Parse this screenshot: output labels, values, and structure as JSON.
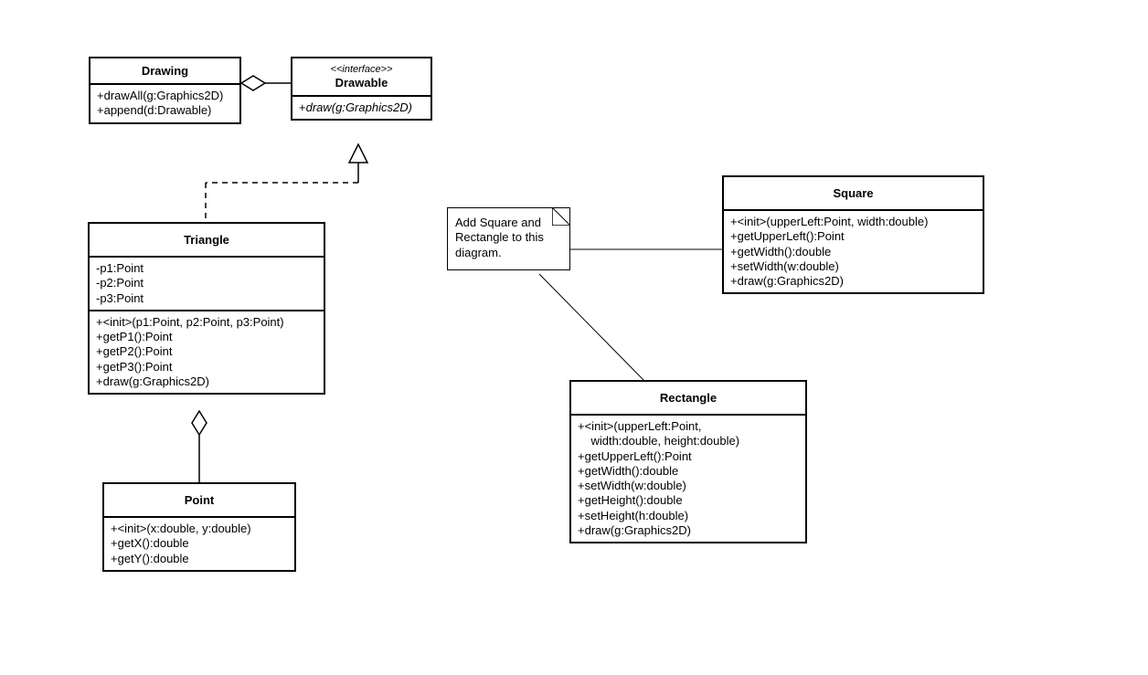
{
  "chart_data": {
    "type": "uml-class-diagram",
    "classes": [
      {
        "name": "Drawing",
        "stereotype": null,
        "attributes": [],
        "operations": [
          "+drawAll(g:Graphics2D)",
          "+append(d:Drawable)"
        ]
      },
      {
        "name": "Drawable",
        "stereotype": "<<interface>>",
        "attributes": [],
        "operations": [
          "+draw(g:Graphics2D)"
        ],
        "operationsItalic": [
          true
        ]
      },
      {
        "name": "Triangle",
        "stereotype": null,
        "attributes": [
          "-p1:Point",
          "-p2:Point",
          "-p3:Point"
        ],
        "operations": [
          "+<init>(p1:Point, p2:Point, p3:Point)",
          "+getP1():Point",
          "+getP2():Point",
          "+getP3():Point",
          "+draw(g:Graphics2D)"
        ]
      },
      {
        "name": "Point",
        "stereotype": null,
        "attributes": [],
        "operations": [
          "+<init>(x:double, y:double)",
          "+getX():double",
          "+getY():double"
        ]
      },
      {
        "name": "Square",
        "stereotype": null,
        "attributes": [],
        "operations": [
          "+<init>(upperLeft:Point, width:double)",
          "+getUpperLeft():Point",
          "+getWidth():double",
          "+setWidth(w:double)",
          "+draw(g:Graphics2D)"
        ]
      },
      {
        "name": "Rectangle",
        "stereotype": null,
        "attributes": [],
        "operations": [
          "+<init>(upperLeft:Point,\n    width:double, height:double)",
          "+getUpperLeft():Point",
          "+getWidth():double",
          "+setWidth(w:double)",
          "+getHeight():double",
          "+setHeight(h:double)",
          "+draw(g:Graphics2D)"
        ]
      }
    ],
    "note": "Add Square and\nRectangle to this\ndiagram.",
    "relationships": [
      {
        "from": "Drawing",
        "to": "Drawable",
        "type": "aggregation",
        "end": "Drawing"
      },
      {
        "from": "Triangle",
        "to": "Drawable",
        "type": "realization"
      },
      {
        "from": "Triangle",
        "to": "Point",
        "type": "aggregation",
        "end": "Triangle"
      },
      {
        "from": "note",
        "to": "Square",
        "type": "note-link"
      },
      {
        "from": "note",
        "to": "Rectangle",
        "type": "note-link"
      }
    ]
  },
  "drawing": {
    "title": "Drawing",
    "ops": [
      "+drawAll(g:Graphics2D)",
      "+append(d:Drawable)"
    ]
  },
  "drawable": {
    "stereo": "<<interface>>",
    "title": "Drawable",
    "ops": [
      "+draw(g:Graphics2D)"
    ]
  },
  "triangle": {
    "title": "Triangle",
    "attrs": [
      "-p1:Point",
      "-p2:Point",
      "-p3:Point"
    ],
    "ops": [
      "+<init>(p1:Point, p2:Point, p3:Point)",
      "+getP1():Point",
      "+getP2():Point",
      "+getP3():Point",
      "+draw(g:Graphics2D)"
    ]
  },
  "point": {
    "title": "Point",
    "ops": [
      "+<init>(x:double, y:double)",
      "+getX():double",
      "+getY():double"
    ]
  },
  "square": {
    "title": "Square",
    "ops": [
      "+<init>(upperLeft:Point, width:double)",
      "+getUpperLeft():Point",
      "+getWidth():double",
      "+setWidth(w:double)",
      "+draw(g:Graphics2D)"
    ]
  },
  "rectangle": {
    "title": "Rectangle",
    "ops": [
      "+<init>(upperLeft:Point,",
      "    width:double, height:double)",
      "+getUpperLeft():Point",
      "+getWidth():double",
      "+setWidth(w:double)",
      "+getHeight():double",
      "+setHeight(h:double)",
      "+draw(g:Graphics2D)"
    ]
  },
  "note": {
    "line1": "Add Square and",
    "line2": "Rectangle to this",
    "line3": "diagram."
  }
}
